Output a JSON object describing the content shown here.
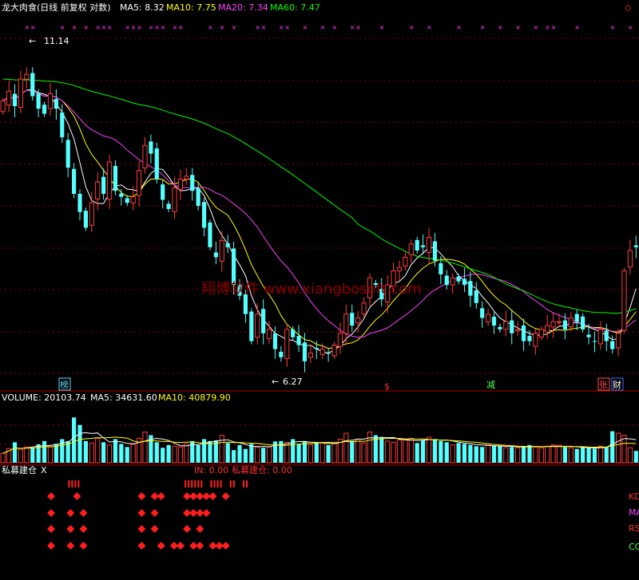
{
  "header": {
    "stock_title": "龙大肉食(日线 前复权 对数)",
    "ma5_label": "MA5: 8.32",
    "ma10_label": "MA10: 7.75",
    "ma20_label": "MA20: 7.34",
    "ma60_label": "MA60: 7.47",
    "corner_icon": "◇"
  },
  "watermark": "翔博软件 www.xiangbosoft.com",
  "price_panel": {
    "high_label": "11.14",
    "low_label": "6.27",
    "badges": [
      {
        "text": "榜",
        "color": "#5fd7ff",
        "frame": "#5fd7ff"
      },
      {
        "text": "$",
        "color": "#ff3030",
        "frame": ""
      },
      {
        "text": "减",
        "color": "#50ff50",
        "frame": ""
      },
      {
        "text": "张",
        "color": "#ff5050",
        "frame": "#ff5050"
      },
      {
        "text": "财",
        "color": "#ffffff",
        "frame": "#3a6dff"
      }
    ]
  },
  "volume_panel": {
    "volume_label": "VOLUME: 20103.74",
    "ma5_label": "MA5: 34631.60",
    "ma10_label": "MA10: 40879.90"
  },
  "indicator_panel": {
    "name": "私募建仓",
    "close_glyph": "X",
    "in_label": "IN: 0.00",
    "value_label": "私募建仓: 0.00",
    "right_labels": [
      "KD",
      "MA",
      "RS",
      "CC"
    ],
    "right_label_colors": [
      "#ff3030",
      "#ff40ff",
      "#ff3030",
      "#50ff50"
    ]
  },
  "colors": {
    "up": "#ff3c3c",
    "down": "#54ffff",
    "ma5": "#ffffff",
    "ma10": "#ffff00",
    "ma20": "#ff40ff",
    "ma60": "#00ff00",
    "grid": "#8b0000",
    "frame": "#b00000",
    "marker": "#ff3df0"
  },
  "chart_data": {
    "type": "candlestick",
    "price_scale": "log",
    "ylim": [
      6.0,
      12.3
    ],
    "grid": true,
    "high_point": 11.14,
    "low_point": 6.27,
    "markers_top_row": [
      4,
      5,
      10,
      12,
      14,
      16,
      17,
      18,
      21,
      22,
      23,
      25,
      26,
      27,
      29,
      30,
      35,
      37,
      39,
      43,
      44,
      47,
      48,
      51,
      54,
      56,
      59,
      60,
      64,
      69,
      72,
      77,
      81,
      84,
      87,
      90,
      92,
      93,
      97,
      103,
      106
    ],
    "closes": [
      10.45,
      10.65,
      10.35,
      10.9,
      11.0,
      10.55,
      10.3,
      10.2,
      10.6,
      10.3,
      9.75,
      9.2,
      8.75,
      8.45,
      8.2,
      8.6,
      8.95,
      8.75,
      9.3,
      8.8,
      8.7,
      8.6,
      8.7,
      9.15,
      9.6,
      9.45,
      9.0,
      8.65,
      8.5,
      8.85,
      9.0,
      9.05,
      8.8,
      8.55,
      8.2,
      7.9,
      7.75,
      8.0,
      7.9,
      7.35,
      7.2,
      6.95,
      6.6,
      6.95,
      6.7,
      6.75,
      6.5,
      6.4,
      6.75,
      6.65,
      6.55,
      6.35,
      6.45,
      6.5,
      6.5,
      6.45,
      6.55,
      6.7,
      6.95,
      6.8,
      6.9,
      7.1,
      7.45,
      7.35,
      7.15,
      7.35,
      7.55,
      7.6,
      7.75,
      7.95,
      7.85,
      7.9,
      8.05,
      7.7,
      7.5,
      7.35,
      7.45,
      7.4,
      7.35,
      7.2,
      7.1,
      6.9,
      6.95,
      6.8,
      6.75,
      6.85,
      6.7,
      6.75,
      6.6,
      6.6,
      6.7,
      6.75,
      6.8,
      6.85,
      6.85,
      6.75,
      6.9,
      6.85,
      6.75,
      6.65,
      6.6,
      6.75,
      6.6,
      6.5,
      6.7,
      7.55,
      7.85,
      7.9
    ],
    "ma_series": [
      {
        "name": "MA5",
        "value": 8.32,
        "color": "#ffffff"
      },
      {
        "name": "MA10",
        "value": 7.75,
        "color": "#ffff00"
      },
      {
        "name": "MA20",
        "value": 7.34,
        "color": "#ff40ff"
      },
      {
        "name": "MA60",
        "value": 7.47,
        "color": "#00ff00"
      }
    ],
    "volume": {
      "last": 20103.74,
      "ma5": 34631.6,
      "ma10": 40879.9,
      "ylim": [
        0,
        150000
      ],
      "values": [
        24000,
        36000,
        52000,
        34000,
        40000,
        38000,
        47000,
        55000,
        40000,
        48000,
        60000,
        55000,
        115000,
        96000,
        55000,
        50000,
        62000,
        52000,
        45000,
        60000,
        48000,
        40000,
        47000,
        62000,
        78000,
        70000,
        52000,
        38000,
        45000,
        42000,
        40000,
        48000,
        55000,
        45000,
        60000,
        55000,
        57000,
        70000,
        50000,
        32000,
        45000,
        35000,
        48000,
        42000,
        38000,
        40000,
        54000,
        55000,
        52000,
        60000,
        48000,
        55000,
        45000,
        50000,
        52000,
        45000,
        50000,
        60000,
        75000,
        55000,
        60000,
        50000,
        78000,
        70000,
        65000,
        55000,
        52000,
        58000,
        60000,
        62000,
        50000,
        57000,
        65000,
        60000,
        55000,
        52000,
        45000,
        50000,
        48000,
        45000,
        42000,
        40000,
        45000,
        44000,
        42000,
        38000,
        40000,
        38000,
        42000,
        45000,
        40000,
        38000,
        42000,
        45000,
        44000,
        40000,
        38000,
        35000,
        40000,
        38000,
        36000,
        42000,
        40000,
        80000,
        75000,
        70000,
        38000,
        30000
      ]
    },
    "indicator_rows": [
      {
        "name": "IN",
        "value": 0.0,
        "type": "bar",
        "marks": [
          8,
          9,
          26,
          27,
          28,
          30,
          31,
          33,
          35
        ]
      },
      {
        "name": "KD",
        "type": "dot",
        "marks": [
          5,
          9,
          19,
          21,
          22,
          26,
          27,
          28,
          29,
          30,
          32
        ]
      },
      {
        "name": "MA",
        "type": "dot",
        "marks": [
          5,
          8,
          10,
          19,
          21,
          26,
          27,
          28,
          29
        ]
      },
      {
        "name": "RS",
        "type": "dot",
        "marks": [
          5,
          8,
          10,
          19,
          21,
          26,
          28
        ]
      },
      {
        "name": "CC",
        "type": "dot",
        "marks": [
          5,
          8,
          10,
          19,
          22,
          24,
          25,
          27,
          28,
          30,
          31,
          32
        ]
      }
    ]
  }
}
